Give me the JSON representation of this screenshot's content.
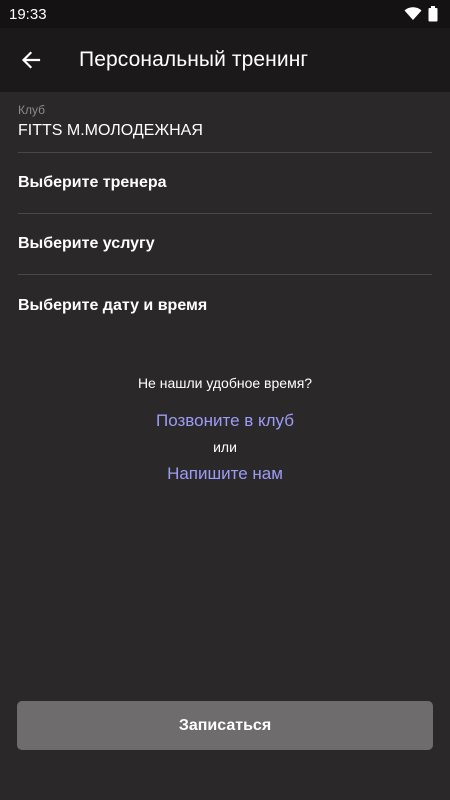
{
  "status_bar": {
    "time": "19:33"
  },
  "app_bar": {
    "title": "Персональный тренинг",
    "back_icon": "arrow-back-icon"
  },
  "form": {
    "club": {
      "caption": "Клуб",
      "value": "FITTS М.МОЛОДЕЖНАЯ"
    },
    "trainer_label": "Выберите тренера",
    "service_label": "Выберите услугу",
    "datetime_label": "Выберите дату и время"
  },
  "help": {
    "question": "Не нашли удобное время?",
    "call_link": "Позвоните в клуб",
    "or": "или",
    "write_link": "Напишите нам"
  },
  "submit_label": "Записаться",
  "colors": {
    "background": "#2b2829",
    "app_bar": "#1b191a",
    "link": "#9c9cf7",
    "button": "#6e6c6d"
  }
}
